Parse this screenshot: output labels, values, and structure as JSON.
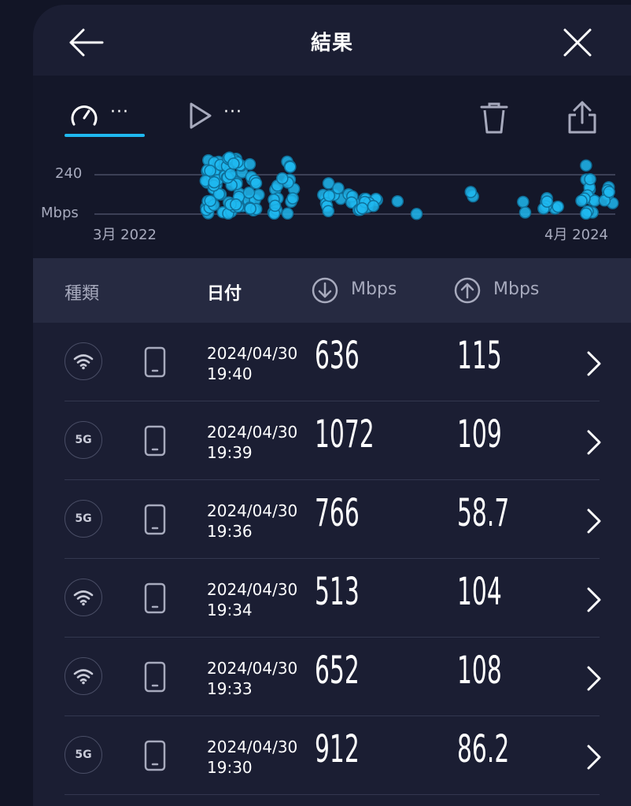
{
  "header": {
    "title": "結果"
  },
  "filter": {
    "speed_more": "···",
    "video_more": "···"
  },
  "chart": {
    "y_tick": "240",
    "y_unit": "Mbps",
    "x_start": "3月 2022",
    "x_end": "4月 2024",
    "dot_color": "#1fb8f0"
  },
  "columns": {
    "type": "種類",
    "date": "日付",
    "download": "Mbps",
    "upload": "Mbps"
  },
  "rows": [
    {
      "type": "wifi",
      "date": "2024/04/30",
      "time": "19:40",
      "download": "636",
      "upload": "115"
    },
    {
      "type": "5G",
      "date": "2024/04/30",
      "time": "19:39",
      "download": "1072",
      "upload": "109"
    },
    {
      "type": "5G",
      "date": "2024/04/30",
      "time": "19:36",
      "download": "766",
      "upload": "58.7"
    },
    {
      "type": "wifi",
      "date": "2024/04/30",
      "time": "19:34",
      "download": "513",
      "upload": "104"
    },
    {
      "type": "wifi",
      "date": "2024/04/30",
      "time": "19:33",
      "download": "652",
      "upload": "108"
    },
    {
      "type": "5G",
      "date": "2024/04/30",
      "time": "19:30",
      "download": "912",
      "upload": "86.2"
    }
  ],
  "colors": {
    "accent": "#1fb8f0",
    "panel": "#1b1e33",
    "header_row": "#262a41"
  }
}
